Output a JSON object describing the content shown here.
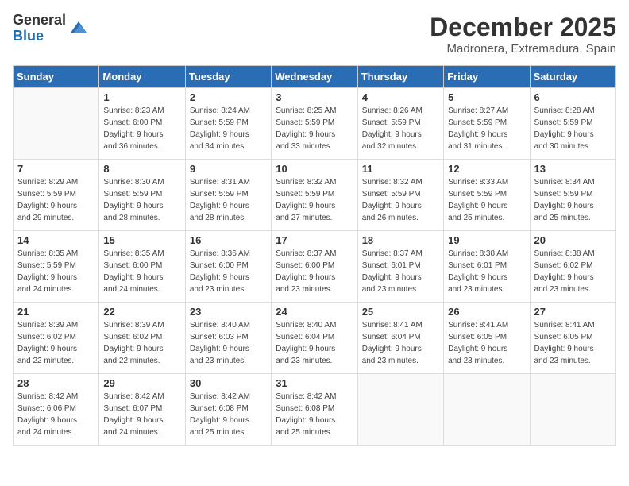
{
  "logo": {
    "general": "General",
    "blue": "Blue"
  },
  "title": "December 2025",
  "subtitle": "Madronera, Extremadura, Spain",
  "weekdays": [
    "Sunday",
    "Monday",
    "Tuesday",
    "Wednesday",
    "Thursday",
    "Friday",
    "Saturday"
  ],
  "weeks": [
    [
      {
        "day": "",
        "info": ""
      },
      {
        "day": "1",
        "info": "Sunrise: 8:23 AM\nSunset: 6:00 PM\nDaylight: 9 hours\nand 36 minutes."
      },
      {
        "day": "2",
        "info": "Sunrise: 8:24 AM\nSunset: 5:59 PM\nDaylight: 9 hours\nand 34 minutes."
      },
      {
        "day": "3",
        "info": "Sunrise: 8:25 AM\nSunset: 5:59 PM\nDaylight: 9 hours\nand 33 minutes."
      },
      {
        "day": "4",
        "info": "Sunrise: 8:26 AM\nSunset: 5:59 PM\nDaylight: 9 hours\nand 32 minutes."
      },
      {
        "day": "5",
        "info": "Sunrise: 8:27 AM\nSunset: 5:59 PM\nDaylight: 9 hours\nand 31 minutes."
      },
      {
        "day": "6",
        "info": "Sunrise: 8:28 AM\nSunset: 5:59 PM\nDaylight: 9 hours\nand 30 minutes."
      }
    ],
    [
      {
        "day": "7",
        "info": "Sunrise: 8:29 AM\nSunset: 5:59 PM\nDaylight: 9 hours\nand 29 minutes."
      },
      {
        "day": "8",
        "info": "Sunrise: 8:30 AM\nSunset: 5:59 PM\nDaylight: 9 hours\nand 28 minutes."
      },
      {
        "day": "9",
        "info": "Sunrise: 8:31 AM\nSunset: 5:59 PM\nDaylight: 9 hours\nand 28 minutes."
      },
      {
        "day": "10",
        "info": "Sunrise: 8:32 AM\nSunset: 5:59 PM\nDaylight: 9 hours\nand 27 minutes."
      },
      {
        "day": "11",
        "info": "Sunrise: 8:32 AM\nSunset: 5:59 PM\nDaylight: 9 hours\nand 26 minutes."
      },
      {
        "day": "12",
        "info": "Sunrise: 8:33 AM\nSunset: 5:59 PM\nDaylight: 9 hours\nand 25 minutes."
      },
      {
        "day": "13",
        "info": "Sunrise: 8:34 AM\nSunset: 5:59 PM\nDaylight: 9 hours\nand 25 minutes."
      }
    ],
    [
      {
        "day": "14",
        "info": "Sunrise: 8:35 AM\nSunset: 5:59 PM\nDaylight: 9 hours\nand 24 minutes."
      },
      {
        "day": "15",
        "info": "Sunrise: 8:35 AM\nSunset: 6:00 PM\nDaylight: 9 hours\nand 24 minutes."
      },
      {
        "day": "16",
        "info": "Sunrise: 8:36 AM\nSunset: 6:00 PM\nDaylight: 9 hours\nand 23 minutes."
      },
      {
        "day": "17",
        "info": "Sunrise: 8:37 AM\nSunset: 6:00 PM\nDaylight: 9 hours\nand 23 minutes."
      },
      {
        "day": "18",
        "info": "Sunrise: 8:37 AM\nSunset: 6:01 PM\nDaylight: 9 hours\nand 23 minutes."
      },
      {
        "day": "19",
        "info": "Sunrise: 8:38 AM\nSunset: 6:01 PM\nDaylight: 9 hours\nand 23 minutes."
      },
      {
        "day": "20",
        "info": "Sunrise: 8:38 AM\nSunset: 6:02 PM\nDaylight: 9 hours\nand 23 minutes."
      }
    ],
    [
      {
        "day": "21",
        "info": "Sunrise: 8:39 AM\nSunset: 6:02 PM\nDaylight: 9 hours\nand 22 minutes."
      },
      {
        "day": "22",
        "info": "Sunrise: 8:39 AM\nSunset: 6:02 PM\nDaylight: 9 hours\nand 22 minutes."
      },
      {
        "day": "23",
        "info": "Sunrise: 8:40 AM\nSunset: 6:03 PM\nDaylight: 9 hours\nand 23 minutes."
      },
      {
        "day": "24",
        "info": "Sunrise: 8:40 AM\nSunset: 6:04 PM\nDaylight: 9 hours\nand 23 minutes."
      },
      {
        "day": "25",
        "info": "Sunrise: 8:41 AM\nSunset: 6:04 PM\nDaylight: 9 hours\nand 23 minutes."
      },
      {
        "day": "26",
        "info": "Sunrise: 8:41 AM\nSunset: 6:05 PM\nDaylight: 9 hours\nand 23 minutes."
      },
      {
        "day": "27",
        "info": "Sunrise: 8:41 AM\nSunset: 6:05 PM\nDaylight: 9 hours\nand 23 minutes."
      }
    ],
    [
      {
        "day": "28",
        "info": "Sunrise: 8:42 AM\nSunset: 6:06 PM\nDaylight: 9 hours\nand 24 minutes."
      },
      {
        "day": "29",
        "info": "Sunrise: 8:42 AM\nSunset: 6:07 PM\nDaylight: 9 hours\nand 24 minutes."
      },
      {
        "day": "30",
        "info": "Sunrise: 8:42 AM\nSunset: 6:08 PM\nDaylight: 9 hours\nand 25 minutes."
      },
      {
        "day": "31",
        "info": "Sunrise: 8:42 AM\nSunset: 6:08 PM\nDaylight: 9 hours\nand 25 minutes."
      },
      {
        "day": "",
        "info": ""
      },
      {
        "day": "",
        "info": ""
      },
      {
        "day": "",
        "info": ""
      }
    ]
  ]
}
